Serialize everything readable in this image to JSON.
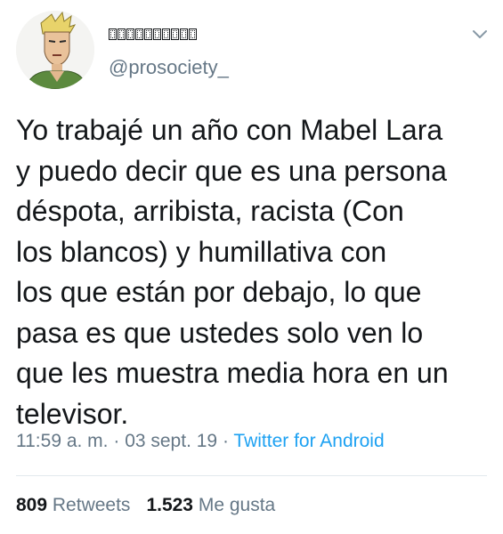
{
  "tweet": {
    "author": {
      "display_name_glyph_count": 10,
      "handle": "@prosociety_"
    },
    "text": "Yo trabajé un año con Mabel Lara\ny puedo decir que es una persona\ndéspota, arribista, racista (Con\nlos blancos) y humillativa con\nlos que están por debajo, lo que\npasa es que ustedes solo ven lo\nque les muestra media hora en un\ntelevisor.",
    "meta": {
      "time": "11:59 a. m.",
      "separator": " · ",
      "date": "03 sept. 19",
      "source": "Twitter for Android"
    },
    "stats": {
      "retweets_count": "809",
      "retweets_label": "Retweets",
      "likes_count": "1.523",
      "likes_label": "Me gusta"
    }
  },
  "icons": {
    "avatar": "avatar-illustration",
    "menu": "chevron-down-icon"
  },
  "colors": {
    "text": "#14171a",
    "secondary": "#657786",
    "link": "#1da1f2",
    "divider": "#e1e8ed"
  }
}
